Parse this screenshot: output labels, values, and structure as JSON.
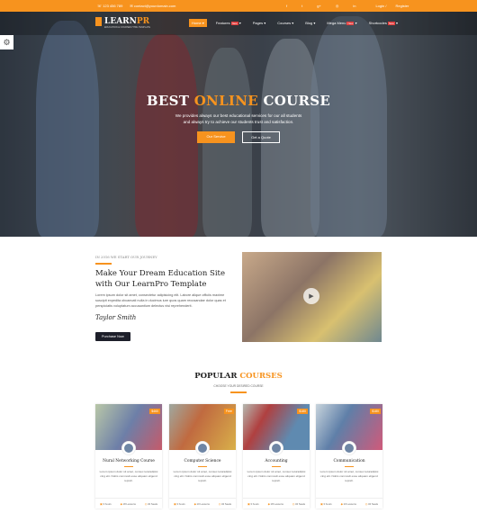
{
  "topbar": {
    "phone": "☏ 123 456 789",
    "email": "✉ contact@yourdomain.com",
    "social": [
      "f",
      "t",
      "g+",
      "◎",
      "in"
    ],
    "login": "Login /",
    "register": "Register"
  },
  "logo": {
    "text": "LEARN",
    "accent": "PR",
    "tagline": "EDUCATION & COURSES HTML TEMPLATE"
  },
  "nav": {
    "items": [
      {
        "label": "Home ▾"
      },
      {
        "label": "Features",
        "badge": "New"
      },
      {
        "label": "Pages ▾"
      },
      {
        "label": "Courses ▾"
      },
      {
        "label": "Blog ▾"
      },
      {
        "label": "Mega Menu",
        "badge": "New"
      },
      {
        "label": "Shortcodes",
        "badge": "New"
      }
    ]
  },
  "hero": {
    "title_a": "BEST ",
    "title_b": "ONLINE",
    "title_c": " COURSE",
    "line1": "We provides always our best educational services for our all students",
    "line2": "and always try to achieve our students trust and satisfaction.",
    "btn1": "Our Service",
    "btn2": "Get a Quote"
  },
  "about": {
    "kicker": "IN 2016 WE START OUR JOURNEY",
    "title": "Make Your Dream Education Site with Our LearnPro Template",
    "text": "Lorem ipsum dolor sit amet, consectetur adipisicing elit. Labore alique officiis maxime suscipit expedita obcaecati nulla in ducimus iure quos quam recusandae dolor quas et perspiciatis voluptatum accusantium delectus nisi reprehenderit.",
    "signature": "Taylor Smith",
    "button": "Purchase Now"
  },
  "courses": {
    "title_a": "POPULAR ",
    "title_b": "COURSES",
    "subtitle": "CHOOSE YOUR DESIRED COURSE",
    "items": [
      {
        "title": "Nural Networking Course",
        "price": "$460",
        "text": "Lorem ipsum dolor sit amet, consec teturadipisi cing elit. Nobis commodi esse aliquam eligend repreh.",
        "hours": "3 hours",
        "lessons": "18 Lessons",
        "seats": "34 Seats"
      },
      {
        "title": "Computer Science",
        "price": "Free",
        "text": "Lorem ipsum dolor sit amet, consec teturadipisi cing elit. Nobis commodi esse aliquam eligend repreh.",
        "hours": "3 hours",
        "lessons": "10 Lessons",
        "seats": "34 Seats"
      },
      {
        "title": "Accounting",
        "price": "$180",
        "text": "Lorem ipsum dolor sit amet, consec teturadipisi cing elit. Nobis commodi esse aliquam eligend repreh.",
        "hours": "3 hours",
        "lessons": "18 Lessons",
        "seats": "34 Seats"
      },
      {
        "title": "Communication",
        "price": "$180",
        "text": "Lorem ipsum dolor sit amet, consec teturadipisi cing elit. Nobis commodi esse aliquam eligend repreh.",
        "hours": "3 hours",
        "lessons": "10 Lessons",
        "seats": "34 Seats"
      }
    ]
  },
  "colors": {
    "accent": "#f7931e",
    "dark": "#1d1f2a"
  }
}
